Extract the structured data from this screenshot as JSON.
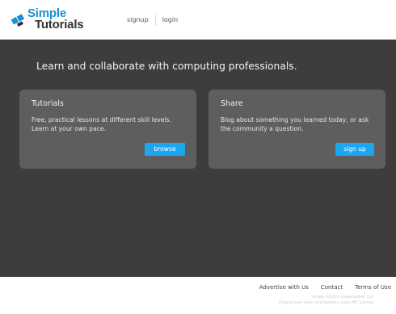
{
  "header": {
    "logo": {
      "line1": "Simple",
      "line2": "Tutorials"
    },
    "nav": [
      {
        "label": "signup"
      },
      {
        "label": "login"
      }
    ]
  },
  "main": {
    "tagline": "Learn and collaborate with computing professionals.",
    "cards": [
      {
        "title": "Tutorials",
        "description": "Free, practical lessons at different skill levels. Learn at your own pace.",
        "button": "browse"
      },
      {
        "title": "Share",
        "description": "Blog about something you learned today, or ask the community a question.",
        "button": "sign up"
      }
    ]
  },
  "footer": {
    "links": [
      {
        "label": "Advertise with Us"
      },
      {
        "label": "Contact"
      },
      {
        "label": "Terms of Use"
      }
    ],
    "copyright_line1": "Simple ©2014, Downloaded, LLC",
    "copyright_line2": "Original user code contributions under MIT License"
  },
  "colors": {
    "brand_blue": "#1a8fd6",
    "button_blue": "#1ca6f0",
    "main_background": "#3d3d3d",
    "card_background": "#5e5e5e"
  },
  "icons": {
    "logo": "tilted-squares-icon"
  }
}
